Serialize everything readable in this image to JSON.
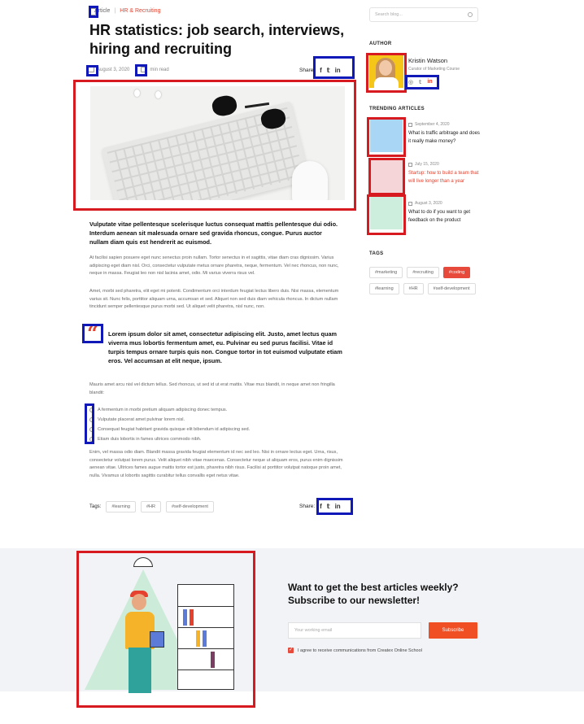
{
  "breadcrumb": {
    "section": "Article",
    "category": "HR & Recruiting"
  },
  "article": {
    "title": "HR statistics: job search,  interviews, hiring and recruiting",
    "date": "August 3, 2020",
    "read_time": "min read",
    "share_label": "Share:",
    "lead": "Vulputate vitae pellentesque scelerisque luctus consequat mattis pellentesque dui odio. Interdum aenean sit malesuada ornare sed gravida rhoncus, congue. Purus auctor nullam diam quis est hendrerit ac euismod.",
    "para1": "At facilisi sapien posuere eget nunc senectus proin nullam. Tortor senectus in et sagittis, vitae diam cras dignissim. Varius adipiscing eget diam nisl. Orci, consectetur vulputate metus ornare pharetra, neque, fermentum. Vel nec rhoncus, non nunc, neque in massa. Feugiat leo non nisl lacinia amet, odio. Mi varius viverra risus vel.",
    "para2": "Amet, morbi sed pharetra, elit eget mi potenti. Condimentum orci interdum feugiat lectus libero duis. Nisi massa, elementum varius sit. Nunc felis, porttitor aliquam urna, accumsan et sed. Aliquet non sed duis diam vehicula rhoncus. In dictum nullam tincidunt semper pellentesque purus morbi sed. Ut aliquet velit pharetra, nisl nunc, non.",
    "quote": "Lorem ipsum dolor sit amet, consectetur adipiscing elit. Justo, amet lectus quam viverra mus lobortis fermentum amet, eu. Pulvinar eu sed purus  facilisi. Vitae id turpis tempus ornare turpis quis non. Congue tortor in tot euismod vulputate etiam eros. Vel accumsan at elit neque, ipsum.",
    "para3": "Mauris amet arcu nisl vel dictum tellus. Sed rhoncus, ut sed id ut erat mattis. Vitae mus blandit, in neque amet non fringilla blandit:",
    "list": [
      "A fermentum in morbi pretium aliquam adipiscing donec tempus.",
      "Vulputate placerat amet pulvinar lorem nisl.",
      "Consequat feugiat habitant gravida quisque elit bibendum id adipiscing sed.",
      "Etiam duis lobortis in fames ultrices commodo nibh."
    ],
    "para4": "Enim, vel massa odio diam. Blandit massa gravida feugiat elementum id nec sed leo. Nisi in ornare lectus eget. Urna, risus, consectetur volutpat lorem purus. Velit aliquet nibh vitae maecenas. Consectetur neque ut aliquam eros, purus enim dignissim aenean vitae. Ultrices fames augue mattis tortor est justo, pharetra nibh risus. Facilisi at porttitor volutpat natoque proin amet, nulla. Vivamus ut lobortis sagittis curabitur tellus convallis eget netus vitae.",
    "tags_label": "Tags:",
    "tags": [
      "#learning",
      "#HR",
      "#self-development"
    ]
  },
  "sidebar": {
    "search_placeholder": "Search blog...",
    "author_heading": "AUTHOR",
    "author_name": "Kristin Watson",
    "author_role": "Curator of Marketing Course",
    "trending_heading": "TRENDING ARTICLES",
    "trending": [
      {
        "date": "September 4, 2020",
        "title": "What is traffic arbitrage and does it really make money?",
        "active": false,
        "thumb": "#a9d6f5"
      },
      {
        "date": "July 15, 2020",
        "title": "Startup: how to build a team that will live longer than a year",
        "active": true,
        "thumb": "#f6d5d8"
      },
      {
        "date": "August 3, 2020",
        "title": "What to do if you want to get feedback on the product",
        "active": false,
        "thumb": "#cdeedd"
      }
    ],
    "tags_heading": "TAGS",
    "tags": [
      "#marketing",
      "#recruiting",
      "#coding",
      "#learning",
      "#HR",
      "#self-development"
    ],
    "active_tag": "#coding"
  },
  "newsletter": {
    "title": "Want to get the best articles weekly? Subscribe to our newsletter!",
    "email_placeholder": "Your working email",
    "button": "Subscribe",
    "consent": "I agree to receive communications from Createx Online School"
  },
  "colors": {
    "accent": "#e5412e",
    "button": "#f04e23",
    "section_bg": "#f2f3f6"
  }
}
